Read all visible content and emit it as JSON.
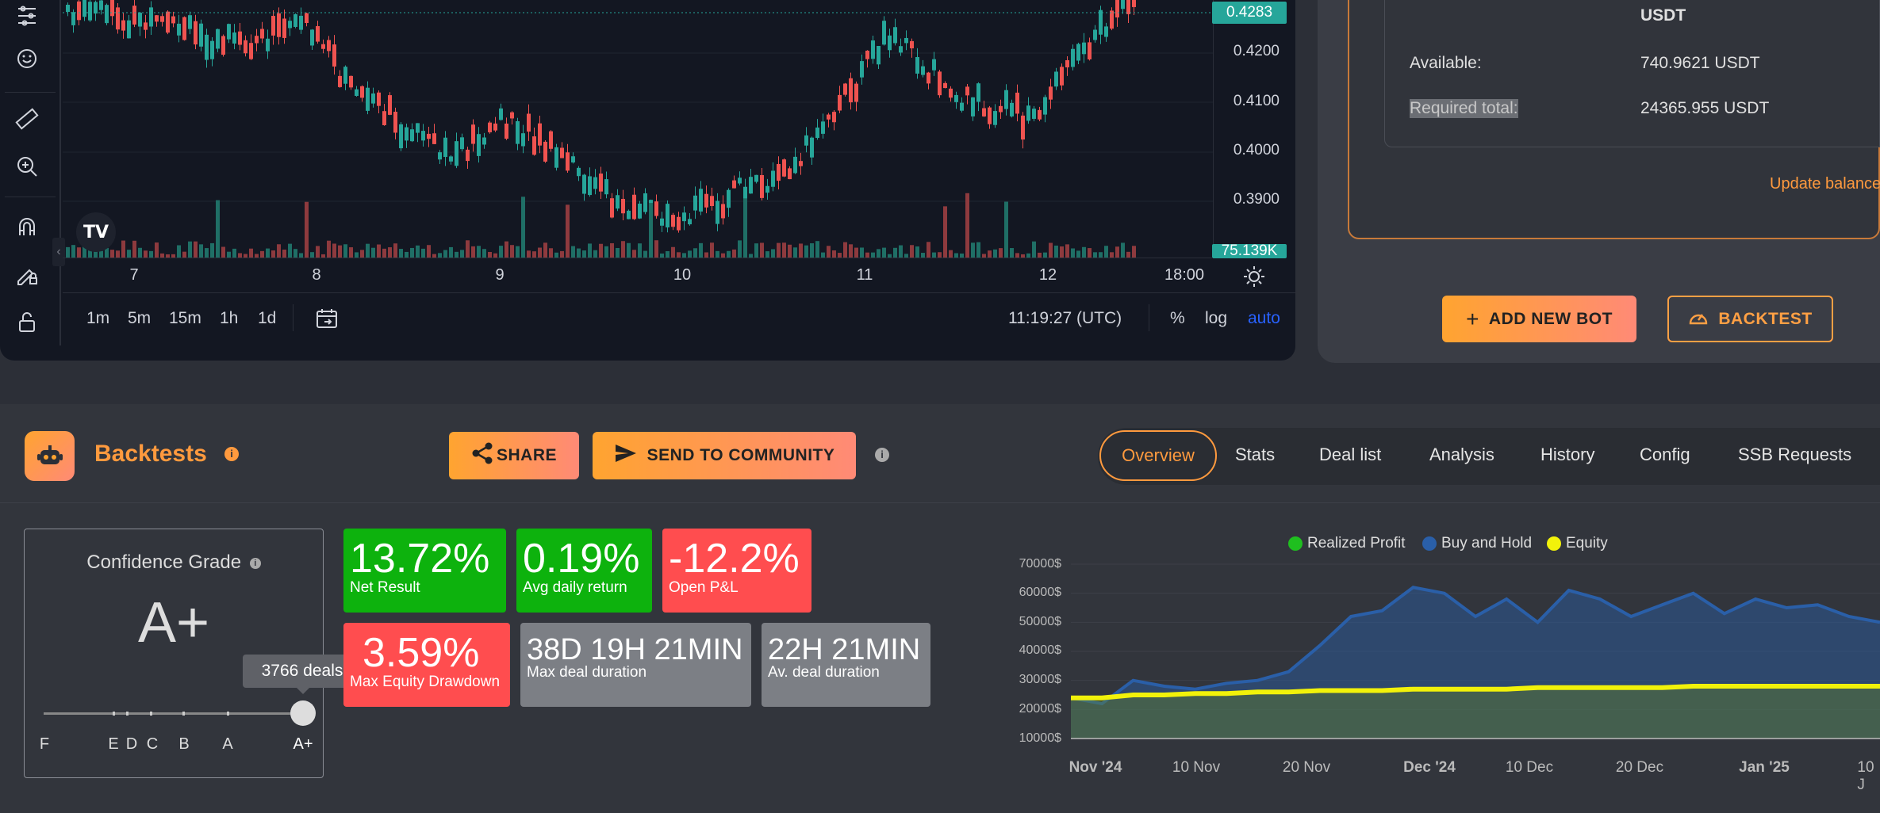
{
  "chart": {
    "price_labels": [
      "0.4200",
      "0.4100",
      "0.4000",
      "0.3900"
    ],
    "current_price": "0.4283",
    "volume_tag": "75.139K",
    "time_labels": [
      "7",
      "8",
      "9",
      "10",
      "11",
      "12",
      "18:00"
    ],
    "timeframes": [
      "1m",
      "5m",
      "15m",
      "1h",
      "1d"
    ],
    "clock": "11:19:27 (UTC)",
    "scale_options": {
      "percent": "%",
      "log": "log",
      "auto": "auto"
    },
    "logo_text": "TV",
    "colors": {
      "up": "#26a69a",
      "down": "#ef5350",
      "up_vol": "#1f6f66",
      "down_vol": "#8e3a3e"
    },
    "toolbar_icons": [
      "settings-sliders-icon",
      "emoji-icon",
      "ruler-icon",
      "zoom-in-icon",
      "magnet-icon",
      "pencil-lock-icon",
      "unlock-icon"
    ]
  },
  "balance": {
    "currency_top": "USDT",
    "available_label": "Available:",
    "available_value": "740.9621 USDT",
    "required_label": "Required total:",
    "required_value": "24365.955 USDT",
    "update_link": "Update balance"
  },
  "actions": {
    "add_bot": "ADD NEW BOT",
    "backtest": "BACKTEST"
  },
  "backtests": {
    "title": "Backtests",
    "share": "SHARE",
    "send_community": "SEND TO COMMUNITY",
    "tabs": [
      "Overview",
      "Stats",
      "Deal list",
      "Analysis",
      "History",
      "Config",
      "SSB Requests"
    ],
    "active_tab": "Overview"
  },
  "grade": {
    "title": "Confidence Grade",
    "value": "A+",
    "tooltip": "3766 deals",
    "marks": [
      "F",
      "E",
      "D",
      "C",
      "B",
      "A",
      "A+"
    ]
  },
  "metrics": [
    {
      "value": "13.72%",
      "label": "Net Result",
      "color": "green"
    },
    {
      "value": "0.19%",
      "label": "Avg daily return",
      "color": "green"
    },
    {
      "value": "-12.2%",
      "label": "Open P&L",
      "color": "red"
    },
    {
      "value": "3.59%",
      "label": "Max Equity Drawdown",
      "color": "red"
    },
    {
      "value": "38D 19H 21MIN",
      "label": "Max deal duration",
      "color": "grey"
    },
    {
      "value": "22H 21MIN",
      "label": "Av. deal duration",
      "color": "grey"
    }
  ],
  "chart_data": {
    "type": "area",
    "title": "",
    "legend": [
      "Realized Profit",
      "Buy and Hold",
      "Equity"
    ],
    "legend_colors": [
      "#1fbf1f",
      "#2a5fa8",
      "#f2f20a"
    ],
    "y_ticks": [
      "70000$",
      "60000$",
      "50000$",
      "40000$",
      "30000$",
      "20000$",
      "10000$"
    ],
    "ylim": [
      10000,
      70000
    ],
    "x_ticks": [
      "Nov '24",
      "10 Nov",
      "20 Nov",
      "Dec '24",
      "10 Dec",
      "20 Dec",
      "Jan '25",
      "10 J"
    ],
    "series": [
      {
        "name": "Buy and Hold",
        "values": [
          24000,
          22000,
          30000,
          28000,
          27000,
          29000,
          30000,
          33000,
          42000,
          52000,
          54000,
          62000,
          60000,
          52000,
          58000,
          50000,
          61000,
          58000,
          52000,
          56000,
          60000,
          53000,
          58000,
          55000,
          56000,
          52000,
          50000
        ]
      },
      {
        "name": "Equity",
        "values": [
          24000,
          24000,
          25000,
          25000,
          25500,
          25500,
          26000,
          26000,
          26500,
          26500,
          26500,
          27000,
          27000,
          27000,
          27000,
          27500,
          27500,
          27500,
          27500,
          27500,
          28000,
          28000,
          28000,
          28000,
          28000,
          28000,
          28000
        ]
      }
    ]
  }
}
